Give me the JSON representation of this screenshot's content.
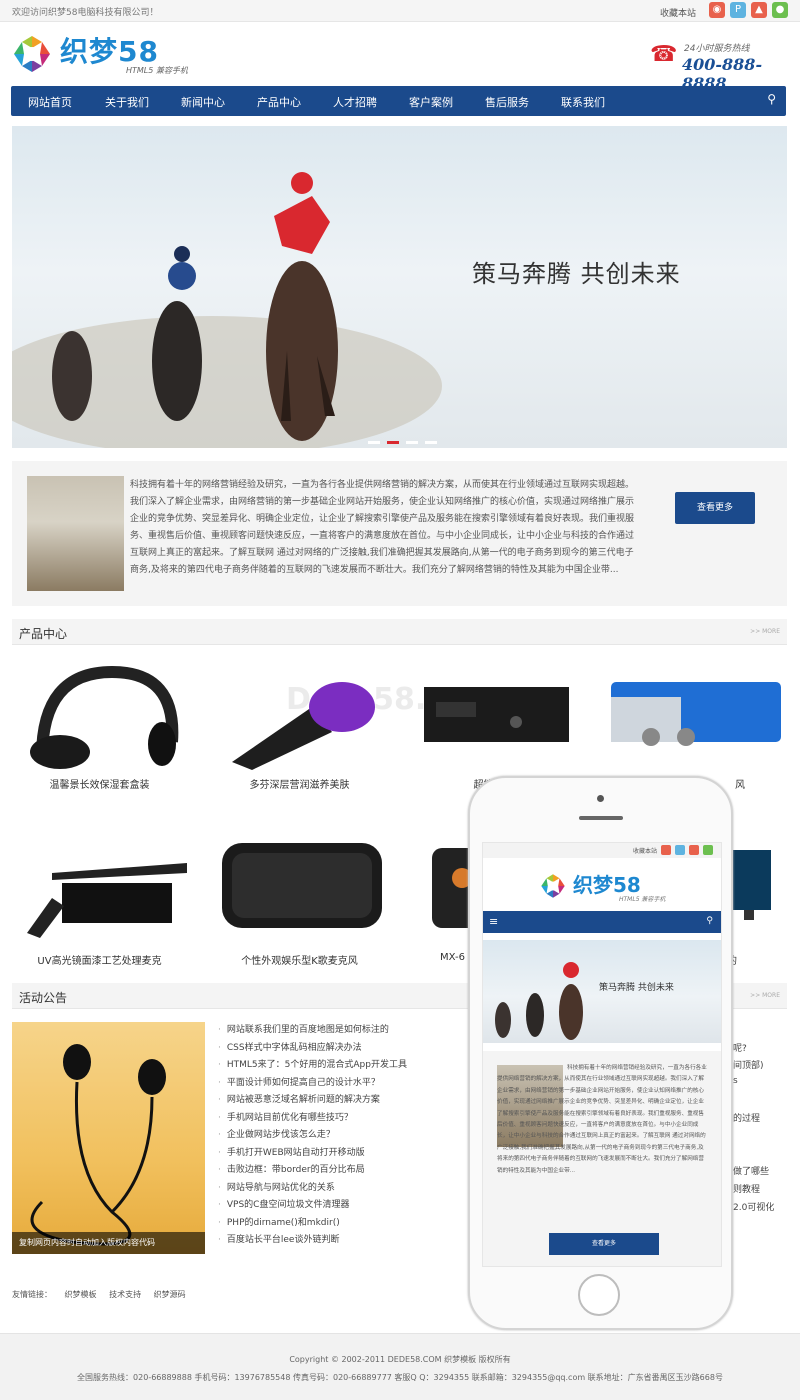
{
  "topbar": {
    "welcome": "欢迎访问织梦58电脑科技有限公司！",
    "favorite": "收藏本站",
    "social_icons": [
      "weibo-icon",
      "tencent-weibo-icon",
      "qq-icon",
      "wechat-icon"
    ],
    "social_colors": [
      "#e8614c",
      "#5eb3e0",
      "#e8614c",
      "#6cbf4f"
    ]
  },
  "header": {
    "brand": "织梦58",
    "brand_sub": "HTML5 兼容手机",
    "hotline_label": "24小时服务热线",
    "hotline": "400-888-8888"
  },
  "nav": {
    "items": [
      "网站首页",
      "关于我们",
      "新闻中心",
      "产品中心",
      "人才招聘",
      "客户案例",
      "售后服务",
      "联系我们"
    ],
    "search_icon": "search-icon",
    "color": "#1b4a8c"
  },
  "banner": {
    "slogan": "策马奔腾 共创未来",
    "slides": 4,
    "active_slide": 2
  },
  "about": {
    "text": "科技拥有着十年的网络营销经验及研究，一直为各行各业提供网络营销的解决方案，从而使其在行业领域通过互联网实现超越。我们深入了解企业需求，由网络营销的第一步基础企业网站开始服务，使企业认知网络推广的核心价值，实现通过网络推广展示企业的竞争优势、突显差异化、明确企业定位，让企业了解搜索引擎使产品及服务能在搜索引擎领域有着良好表现。我们重视服务、重视售后价值、重视顾客问题快速反应，一直将客户的满意度放在首位。与中小企业同成长，让中小企业与科技的合作通过互联网上真正的富起来。了解互联网 通过对网络的广泛接触,我们准确把握其发展路向,从第一代的电子商务到现今的第三代电子商务,及将来的第四代电子商务伴随着的互联网的飞速发展而不断壮大。我们充分了解网络营销的特性及其能为中国企业带...",
    "more": "查看更多"
  },
  "products": {
    "title": "产品中心",
    "more": ">> MORE",
    "row1": [
      "温馨景长效保湿套盒装",
      "多芬深层营润滋养美肤",
      "超能唱歌",
      "风"
    ],
    "row2": [
      "UV高光镜面漆工艺处理麦克",
      "个性外观娱乐型K歌麦克风",
      "MX-6",
      "的"
    ]
  },
  "news": {
    "title": "活动公告",
    "more": ">> MORE",
    "image_caption": "复制网页内容时自动加入版权内容代码",
    "items": [
      "网站联系我们里的百度地图是如何标注的",
      "CSS样式中字体乱码相应解决办法",
      "HTML5来了：5个好用的混合式App开发工具",
      "平面设计师如何提高自己的设计水平？",
      "网站被恶意泛域名解析问题的解决方案",
      "手机网站目前优化有哪些技巧？",
      "企业做网站步伐该怎么走？",
      "手机打开WEB网站自动打开移动版",
      "击败边框：带border的百分比布局",
      "网站导航与网站优化的关系",
      "VPS的C盘空间垃圾文件清理器",
      "PHP的dirname()和mkdir()",
      "百度站长平台lee谈外链判断"
    ],
    "right_fragments": [
      "呢?",
      "间顶部)",
      "s",
      "的过程",
      "做了哪些",
      "则教程",
      "2.0可视化"
    ]
  },
  "links": {
    "label": "友情链接：",
    "items": [
      "织梦模板",
      "技术支持",
      "织梦源码"
    ]
  },
  "footer": {
    "copyright": "Copyright © 2002-2011 DEDE58.COM 织梦模板 版权所有",
    "contact": "全国服务热线：020-66889888 手机号码：13976785548 传真号码：020-66889777 客服Q Q：3294355 联系邮箱：3294355@qq.com 联系地址：广东省番禺区玉沙路668号"
  },
  "watermark": "Dede58.com",
  "phone_mock": {
    "favorite": "收藏本站",
    "brand": "织梦58",
    "brand_sub": "HTML5 兼容手机",
    "slogan": "策马奔腾 共创未来",
    "about_text": "科技拥有着十年的网络营销经验及研究，一直为各行各业提供网络营销的解决方案，从而使其在行业领域通过互联网实现超越。我们深入了解企业需求，由网络营销的第一步基础企业网站开始服务，使企业认知网络推广的核心价值，实现通过网络推广展示企业的竞争优势、突显差异化、明确企业定位，让企业了解搜索引擎使产品及服务能在搜索引擎领域有着良好表现。我们重视服务、重视售后价值、重视顾客问题快速反应，一直将客户的满意度放在首位。与中小企业同成长，让中小企业与科技的合作通过互联网上真正的富起来。了解互联网 通过对网络的广泛接触,我们准确把握其发展路向,从第一代的电子商务到现今的第三代电子商务,及将来的第四代电子商务伴随着的互联网的飞速发展而不断壮大。我们充分了解网络营销的特性及其能为中国企业带...",
    "more": "查看更多"
  }
}
